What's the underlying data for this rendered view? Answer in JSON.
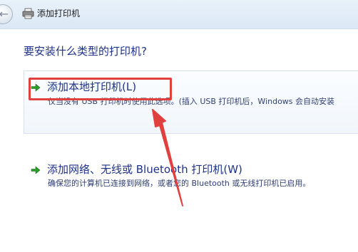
{
  "window": {
    "title": "添加打印机"
  },
  "main": {
    "heading": "要安装什么类型的打印机?",
    "options": [
      {
        "title": "添加本地打印机(L)",
        "description": "仅当没有 USB 打印机时使用此选项。(插入 USB 打印机后，Windows 会自动安装"
      },
      {
        "title": "添加网络、无线或 Bluetooth 打印机(W)",
        "description": "确保您的计算机已连接到网络，或者您的 Bluetooth 或无线打印机已启用。"
      }
    ]
  },
  "colors": {
    "heading_text": "#1e3287",
    "highlight": "#e0413f",
    "arrow_green": "#2a9d2a"
  },
  "icons": {
    "back": "back-arrow-icon",
    "printer": "printer-icon",
    "option_arrow": "green-arrow-icon"
  }
}
